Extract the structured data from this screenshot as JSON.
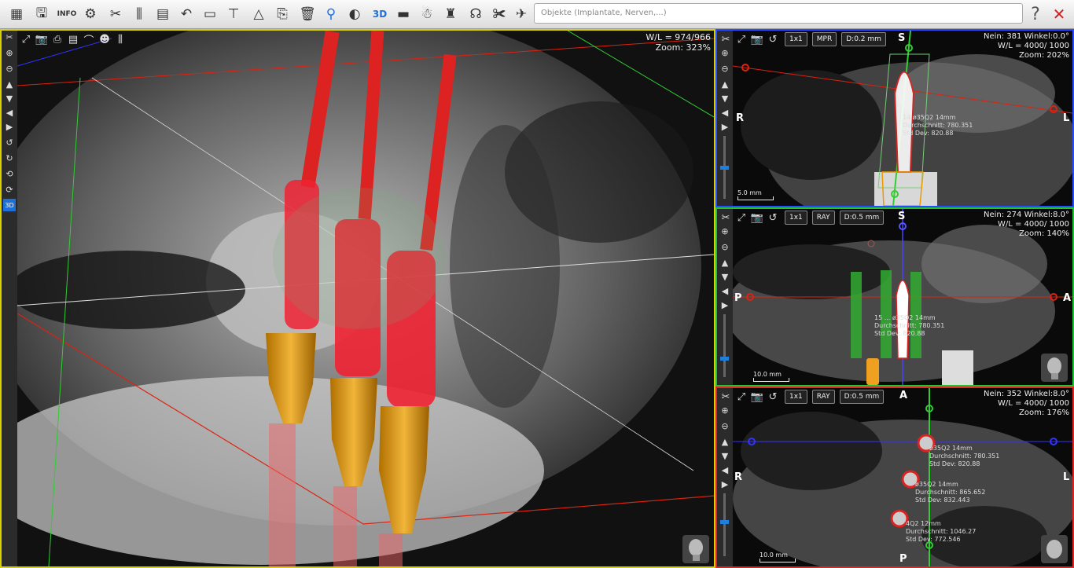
{
  "toolbar": {
    "search_placeholder": "Objekte (Implantate, Nerven,...)",
    "tools_left": [
      "layout-icon",
      "save-icon",
      "info-icon",
      "settings-icon",
      "tools-icon",
      "implant-icon",
      "report-icon",
      "undo-icon",
      "panorama-icon",
      "display-icon",
      "measure-icon",
      "export-icon",
      "delete-icon",
      "axis-icon",
      "contrast-icon",
      "view3d-icon",
      "sleeve-icon",
      "bone-icon",
      "crown-icon",
      "nerve-icon",
      "cut-icon",
      "plane-icon"
    ],
    "help_label": "?",
    "close_label": "✕",
    "colors": {
      "bg": "#e9e9e9"
    }
  },
  "view3d": {
    "wl": "W/L = 974/966",
    "zoom": "Zoom: 323%",
    "frame_color": "#d8d000"
  },
  "views": [
    {
      "id": "mpr",
      "mode_label": "MPR",
      "zoom_btn": "1x1",
      "d_label": "D:0.2 mm",
      "info": [
        "Nein: 381 Winkel:0.0°",
        "W/L = 4000/ 1000",
        "Zoom: 202%"
      ],
      "orient": {
        "top": "S",
        "left": "R",
        "right": "L"
      },
      "annot": [
        "14 ø35Q2 14mm",
        "Durchschnitt: 780.351",
        "Std Dev: 820.88"
      ],
      "scale": "5.0 mm",
      "frame_color": "#2a4cff"
    },
    {
      "id": "ray1",
      "mode_label": "RAY",
      "zoom_btn": "1x1",
      "d_label": "D:0.5 mm",
      "info": [
        "Nein: 274 Winkel:8.0°",
        "W/L = 4000/ 1000",
        "Zoom: 140%"
      ],
      "orient": {
        "top": "S",
        "left": "P",
        "right": "A"
      },
      "annot": [
        "15 ... ø35Q2 14mm",
        "Durchschnitt: 780.351",
        "Std Dev: 820.88"
      ],
      "scale": "10.0 mm",
      "frame_color": "#21c233"
    },
    {
      "id": "ray2",
      "mode_label": "RAY",
      "zoom_btn": "1x1",
      "d_label": "D:0.5 mm",
      "info": [
        "Nein: 352 Winkel:8.0°",
        "W/L = 4000/ 1000",
        "Zoom: 176%"
      ],
      "orient": {
        "top": "A",
        "bottom": "P",
        "left": "R",
        "right": "L"
      },
      "annot1": [
        "ø35Q2 14mm",
        "Durchschnitt: 780.351",
        "Std Dev: 820.88"
      ],
      "annot2": [
        "ø35Q2 14mm",
        "Durchschnitt: 865.652",
        "Std Dev: 832.443"
      ],
      "annot3": [
        "4Q2 12mm",
        "Durchschnitt: 1046.27",
        "Std Dev: 772.546"
      ],
      "scale": "10.0 mm",
      "frame_color": "#e22424"
    }
  ]
}
